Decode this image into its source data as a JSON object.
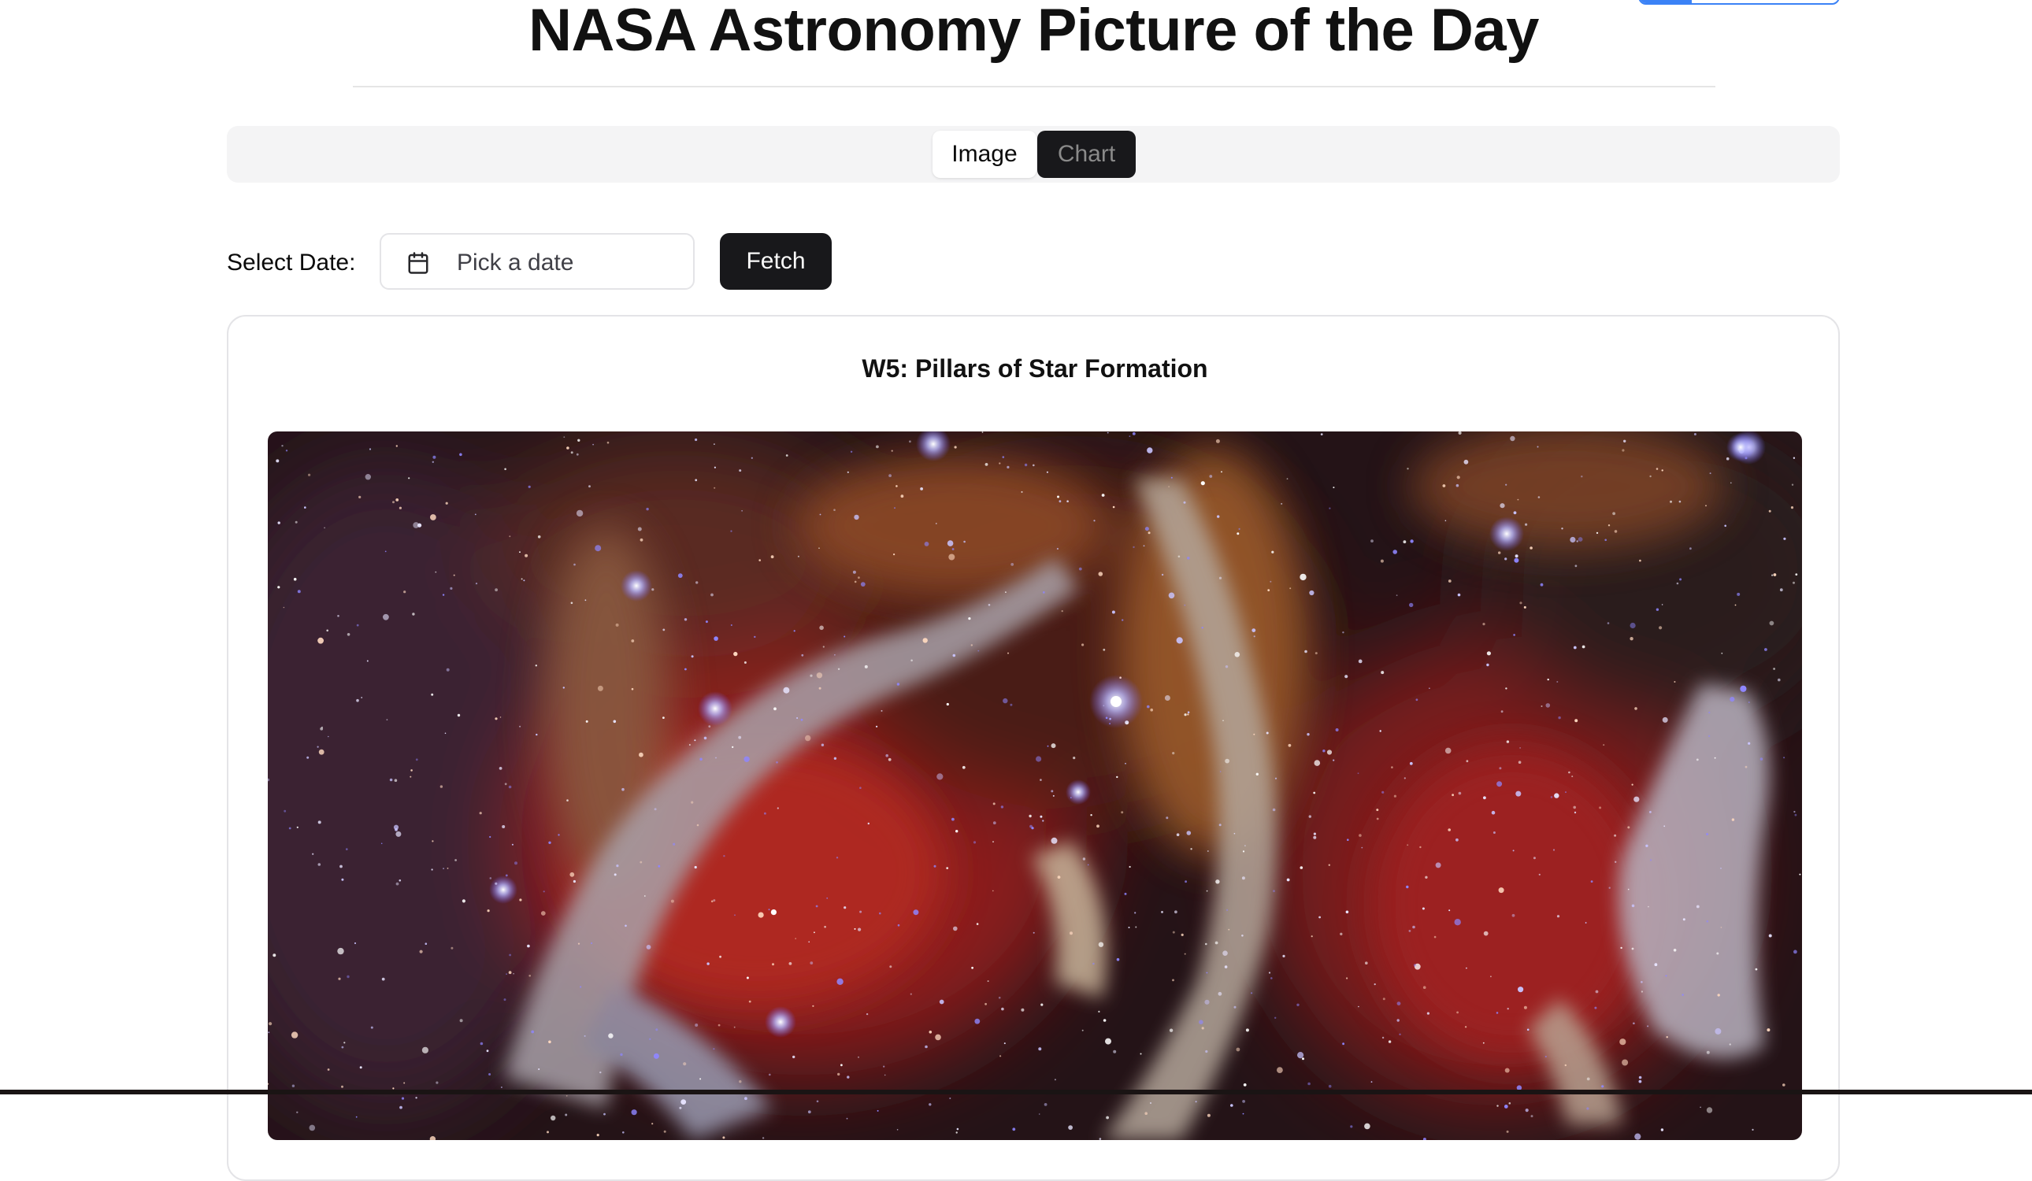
{
  "header": {
    "title": "NASA Astronomy Picture of the Day"
  },
  "view_tabs": [
    {
      "label": "Image",
      "active": true
    },
    {
      "label": "Chart",
      "active": false
    }
  ],
  "controls": {
    "select_label": "Select Date:",
    "date_placeholder": "Pick a date",
    "calendar_icon": "calendar-icon",
    "fetch_label": "Fetch"
  },
  "apod": {
    "title": "W5: Pillars of Star Formation",
    "image_alt": "W5: Pillars of Star Formation"
  },
  "colors": {
    "primary_dark": "#18181b",
    "tab_bar_bg": "#f4f4f5",
    "border": "#e4e4e7",
    "accent_blue": "#3b82f6"
  }
}
